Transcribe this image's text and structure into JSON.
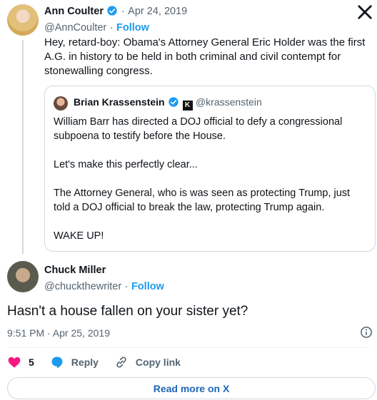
{
  "parent_tweet": {
    "author_name": "Ann Coulter",
    "separator": "·",
    "date": "Apr 24, 2019",
    "handle": "@AnnCoulter",
    "follow_label": "Follow",
    "text": "Hey, retard-boy: Obama's Attorney General Eric Holder was the first A.G. in history to be held in both criminal and civil contempt for stonewalling congress."
  },
  "quoted_tweet": {
    "author_name": "Brian Krassenstein",
    "badge": "K",
    "handle": "@krassenstein",
    "paragraphs": [
      "William Barr has directed a DOJ official to defy a congressional subpoena to testify before the House.",
      "Let's make this perfectly clear...",
      "The Attorney General, who is was seen as protecting Trump, just told a DOJ official to break the law, protecting Trump again.",
      "WAKE UP!"
    ]
  },
  "reply_tweet": {
    "author_name": "Chuck Miller",
    "handle": "@chuckthewriter",
    "follow_label": "Follow",
    "text": "Hasn't a house fallen on your sister yet?",
    "timestamp": "9:51 PM · Apr 25, 2019"
  },
  "actions": {
    "like_count": "5",
    "reply_label": "Reply",
    "copy_link_label": "Copy link"
  },
  "read_more_label": "Read more on X",
  "colors": {
    "accent": "#1d9bf0",
    "like": "#f91880",
    "muted": "#536471"
  }
}
